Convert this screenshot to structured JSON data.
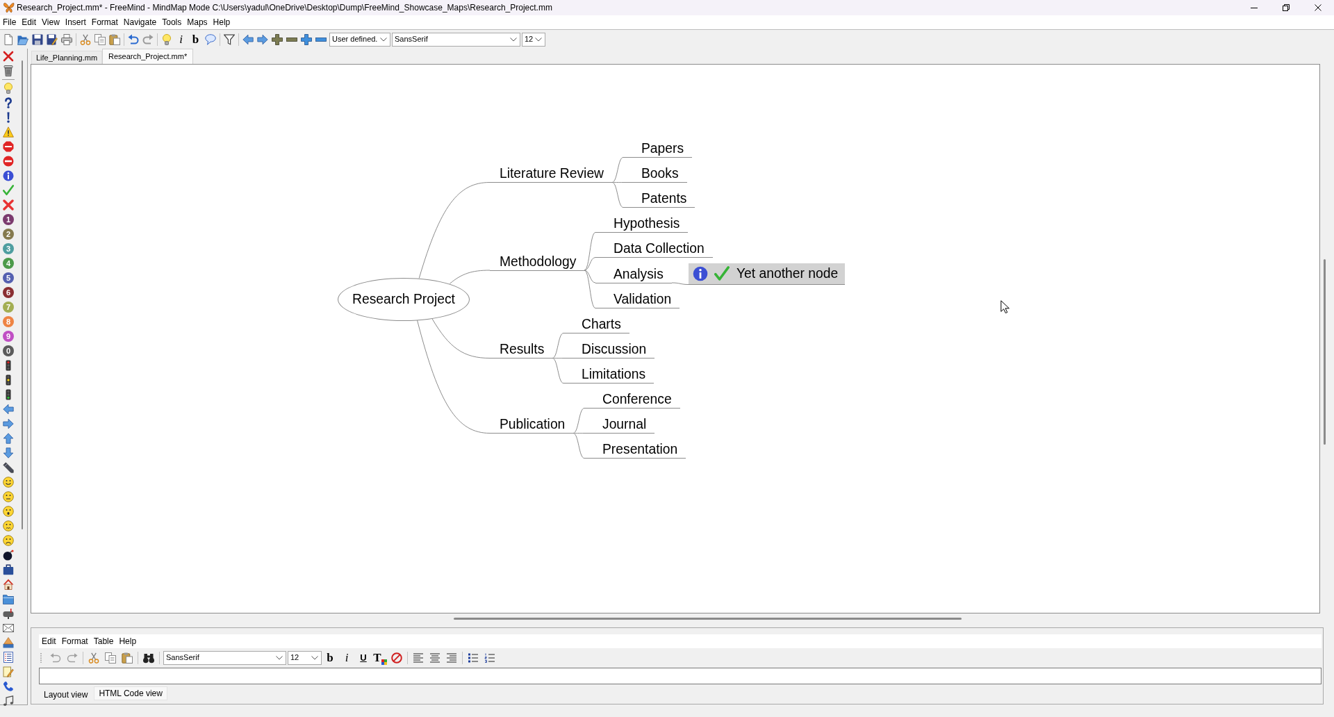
{
  "window": {
    "title": "Research_Project.mm* - FreeMind - MindMap Mode C:\\Users\\yadul\\OneDrive\\Desktop\\Dump\\FreeMind_Showcase_Maps\\Research_Project.mm"
  },
  "menu": [
    "File",
    "Edit",
    "View",
    "Insert",
    "Format",
    "Navigate",
    "Tools",
    "Maps",
    "Help"
  ],
  "toolbar": {
    "glyph_buttons": [
      "i",
      "b"
    ],
    "zoom": "User defined.",
    "font": "SansSerif",
    "font_size": "12"
  },
  "icon_bar": {
    "priority_icons": [
      {
        "label": "1",
        "color": "#7b3a6e"
      },
      {
        "label": "2",
        "color": "#857a4e"
      },
      {
        "label": "3",
        "color": "#4e9ea0"
      },
      {
        "label": "4",
        "color": "#4c9a4a"
      },
      {
        "label": "5",
        "color": "#5560b0"
      },
      {
        "label": "6",
        "color": "#8a2e32"
      },
      {
        "label": "7",
        "color": "#a3ae52"
      },
      {
        "label": "8",
        "color": "#ee8444"
      },
      {
        "label": "9",
        "color": "#c04fc4"
      },
      {
        "label": "0",
        "color": "#5a5a5a"
      }
    ]
  },
  "tabs": [
    {
      "label": "Life_Planning.mm",
      "selected": false
    },
    {
      "label": "Research_Project.mm*",
      "selected": true
    }
  ],
  "mindmap": {
    "root": {
      "text": "Research Project",
      "kind": "bubble",
      "selected": false,
      "children": [
        {
          "text": "Literature Review",
          "kind": "fork",
          "selected": false,
          "children": [
            {
              "text": "Papers",
              "kind": "fork",
              "selected": false
            },
            {
              "text": "Books",
              "kind": "fork",
              "selected": false
            },
            {
              "text": "Patents",
              "kind": "fork",
              "selected": false
            }
          ]
        },
        {
          "text": "Methodology",
          "kind": "fork",
          "selected": false,
          "children": [
            {
              "text": "Hypothesis",
              "kind": "fork",
              "selected": false
            },
            {
              "text": "Data Collection",
              "kind": "fork",
              "selected": false
            },
            {
              "text": "Analysis",
              "kind": "fork",
              "selected": false,
              "children": [
                {
                  "text": "Yet another node",
                  "kind": "annotated",
                  "selected": true
                }
              ]
            },
            {
              "text": "Validation",
              "kind": "fork",
              "selected": false
            }
          ]
        },
        {
          "text": "Results",
          "kind": "fork",
          "selected": false,
          "children": [
            {
              "text": "Charts",
              "kind": "fork",
              "selected": false
            },
            {
              "text": "Discussion",
              "kind": "fork",
              "selected": false
            },
            {
              "text": "Limitations",
              "kind": "fork",
              "selected": false
            }
          ]
        },
        {
          "text": "Publication",
          "kind": "fork",
          "selected": false,
          "children": [
            {
              "text": "Conference",
              "kind": "fork",
              "selected": false
            },
            {
              "text": "Journal",
              "kind": "fork",
              "selected": false
            },
            {
              "text": "Presentation",
              "kind": "fork",
              "selected": false
            }
          ]
        }
      ]
    }
  },
  "editor": {
    "menu": [
      "Edit",
      "Format",
      "Table",
      "Help"
    ],
    "font": "SansSerif",
    "font_size": "12",
    "glyph_buttons": [
      "b",
      "i",
      "U",
      "T"
    ],
    "tabs": [
      {
        "label": "Layout view",
        "selected": true
      },
      {
        "label": "HTML Code view",
        "selected": false
      }
    ]
  }
}
